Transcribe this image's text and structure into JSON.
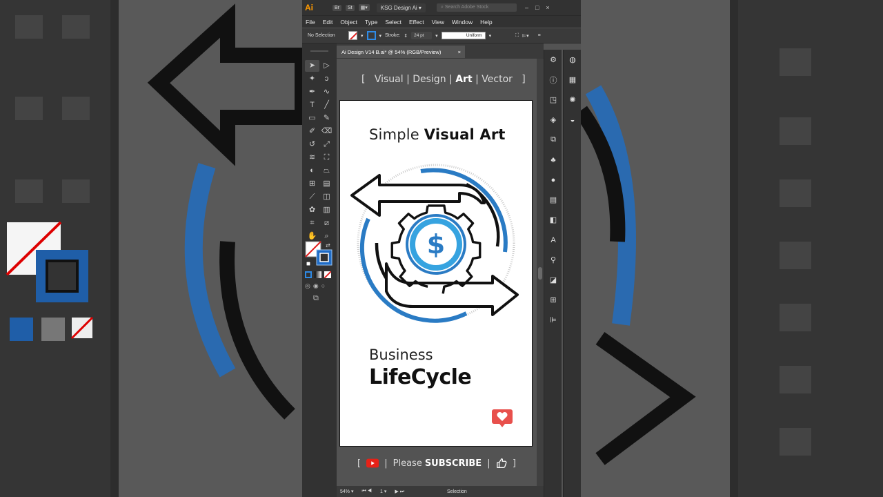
{
  "app": {
    "logo": "Ai",
    "bridge_btn": "Br",
    "stock_btn": "St",
    "workspace": "KSG Design Ai",
    "search_placeholder": "Search Adobe Stock"
  },
  "menu": [
    "File",
    "Edit",
    "Object",
    "Type",
    "Select",
    "Effect",
    "View",
    "Window",
    "Help"
  ],
  "control_bar": {
    "selection_label": "No Selection",
    "stroke_label": "Stroke:",
    "stroke_weight": "24 pt",
    "profile": "Uniform"
  },
  "document_tab": {
    "title": "Ai Design V14 B.ai* @ 54% (RGB/Preview)",
    "close": "×"
  },
  "tagline": {
    "open_bracket": "[",
    "part1": "Visual",
    "sep1": "|",
    "part2": "Design",
    "sep2": "|",
    "part3": "Art",
    "sep3": "|",
    "part4": "Vector",
    "close_bracket": "]"
  },
  "artboard": {
    "title_light": "Simple ",
    "title_bold": "Visual Art",
    "subtitle": "Business",
    "heading": "LifeCycle",
    "dollar": "$"
  },
  "subscribe": {
    "open_bracket": "[",
    "sep1": "|",
    "please": "Please",
    "subscribe": "SUBSCRIBE",
    "sep2": "|",
    "close_bracket": "]"
  },
  "status_bar": {
    "zoom": "54%",
    "artboard_num": "1",
    "tool": "Selection"
  },
  "colors": {
    "accent_blue": "#2a7bc4",
    "light_blue": "#36a3e0",
    "ai_orange": "#ff9a00",
    "youtube_red": "#e62117"
  },
  "icons": {
    "toolbox": [
      "selection-tool-icon",
      "direct-selection-tool-icon",
      "magic-wand-icon",
      "lasso-icon",
      "pen-tool-icon",
      "curvature-icon",
      "type-tool-icon",
      "line-tool-icon",
      "rectangle-tool-icon",
      "paintbrush-icon",
      "shaper-icon",
      "eraser-icon",
      "rotate-icon",
      "scale-icon",
      "warp-icon",
      "free-transform-icon",
      "shape-builder-icon",
      "perspective-icon",
      "mesh-icon",
      "gradient-icon",
      "eyedropper-icon",
      "blend-icon",
      "symbol-sprayer-icon",
      "column-graph-icon",
      "artboard-tool-icon",
      "slice-icon",
      "hand-icon",
      "zoom-icon"
    ],
    "panels_a": [
      "properties-icon",
      "info-icon",
      "libraries-icon",
      "layers-icon",
      "artboards-icon",
      "symbols-icon",
      "appearance-icon",
      "gradient-icon",
      "transparency-icon",
      "character-icon",
      "puppet-icon",
      "pathfinder-icon",
      "transform-icon",
      "align-icon"
    ],
    "panels_b": [
      "color-icon",
      "swatches-icon",
      "brushes-icon",
      "graphic-styles-icon"
    ]
  }
}
